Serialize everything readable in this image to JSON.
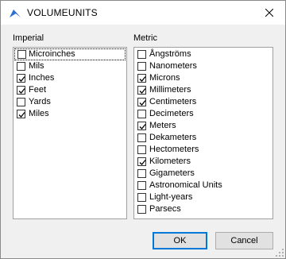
{
  "window": {
    "title": "VOLUMEUNITS",
    "app_icon": "app-logo-icon",
    "close_icon": "close-icon"
  },
  "imperial": {
    "label": "Imperial",
    "items": [
      {
        "label": "Microinches",
        "checked": false,
        "focused": true
      },
      {
        "label": "Mils",
        "checked": false
      },
      {
        "label": "Inches",
        "checked": true
      },
      {
        "label": "Feet",
        "checked": true
      },
      {
        "label": "Yards",
        "checked": false
      },
      {
        "label": "Miles",
        "checked": true
      }
    ]
  },
  "metric": {
    "label": "Metric",
    "items": [
      {
        "label": "Ångströms",
        "checked": false
      },
      {
        "label": "Nanometers",
        "checked": false
      },
      {
        "label": "Microns",
        "checked": true
      },
      {
        "label": "Millimeters",
        "checked": true
      },
      {
        "label": "Centimeters",
        "checked": true
      },
      {
        "label": "Decimeters",
        "checked": false
      },
      {
        "label": "Meters",
        "checked": true
      },
      {
        "label": "Dekameters",
        "checked": false
      },
      {
        "label": "Hectometers",
        "checked": false
      },
      {
        "label": "Kilometers",
        "checked": true
      },
      {
        "label": "Gigameters",
        "checked": false
      },
      {
        "label": "Astronomical Units",
        "checked": false
      },
      {
        "label": "Light-years",
        "checked": false
      },
      {
        "label": "Parsecs",
        "checked": false
      }
    ]
  },
  "buttons": {
    "ok": "OK",
    "cancel": "Cancel"
  },
  "colors": {
    "accent": "#0078d7",
    "dialog_bg": "#f0f0f0"
  }
}
